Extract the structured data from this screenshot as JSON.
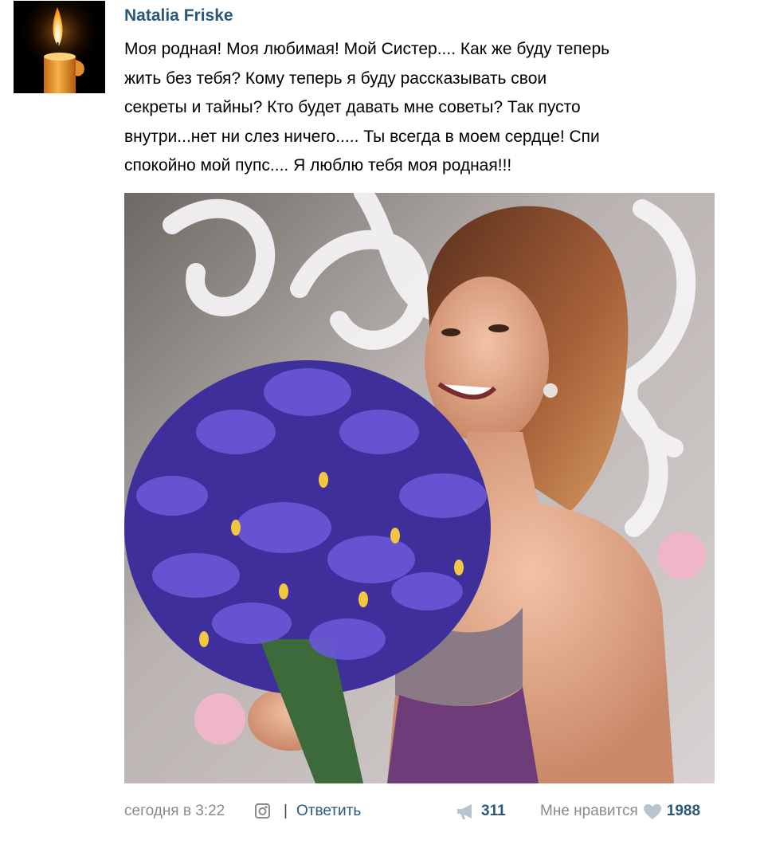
{
  "post": {
    "author": "Natalia Friske",
    "avatar_icon": "candle-icon",
    "text_lines": [
      "Моя родная! Моя любимая! Мой Систер.... Как же буду теперь",
      "жить без тебя? Кому теперь я буду рассказывать свои",
      "секреты и тайны? Кто будет давать мне советы? Так пусто",
      "внутри...нет ни слез ничего..... Ты всегда в моем сердце! Спи",
      "спокойно мой пупс.... Я люблю тебя моя родная!!!"
    ],
    "photo_icon": "photo-woman-with-irises"
  },
  "footer": {
    "timestamp": "сегодня в 3:22",
    "source_icon": "instagram-icon",
    "separator": "|",
    "reply_label": "Ответить",
    "share_icon": "megaphone-icon",
    "share_count": "311",
    "like_label": "Мне нравится",
    "like_icon": "heart-icon",
    "like_count": "1988"
  },
  "colors": {
    "author": "#2b587a",
    "link": "#2b587a",
    "meta_gray": "#8a8a8a",
    "icon_gray": "#b8c4d0"
  }
}
